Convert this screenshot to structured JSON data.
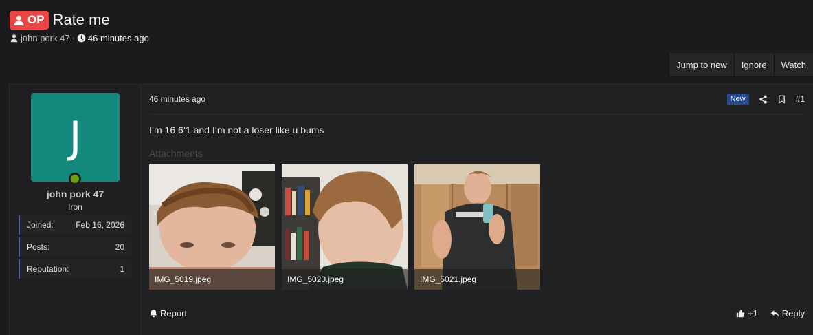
{
  "thread": {
    "op_badge": "OP",
    "title": "Rate me",
    "author": "john pork 47",
    "separator": "·",
    "time": "46 minutes ago"
  },
  "actions": [
    "Jump to new",
    "Ignore",
    "Watch"
  ],
  "user": {
    "avatar_letter": "J",
    "avatar_color": "#12897c",
    "online_color": "#66a50f",
    "name": "john pork 47",
    "rank": "Iron",
    "stats": [
      {
        "label": "Joined:",
        "value": "Feb 16, 2026"
      },
      {
        "label": "Posts:",
        "value": "20"
      },
      {
        "label": "Reputation:",
        "value": "1"
      }
    ]
  },
  "post": {
    "time": "46 minutes ago",
    "new_badge": "New",
    "number": "#1",
    "text": "I’m 16 6’1 and I’m not a loser like u bums",
    "attachments_label": "Attachments",
    "attachments": [
      {
        "filename": "IMG_5019.jpeg"
      },
      {
        "filename": "IMG_5020.jpeg"
      },
      {
        "filename": "IMG_5021.jpeg"
      }
    ],
    "report_label": "Report",
    "reaction_count": "+1",
    "reply_label": "Reply"
  },
  "icons": [
    "user-icon",
    "clock-icon",
    "share-icon",
    "bookmark-icon",
    "bell-icon",
    "thumbs-up-icon",
    "reply-icon"
  ],
  "colors": {
    "op_red": "#e94646",
    "new_blue": "#284a8f",
    "stat_accent": "#4a62a8"
  }
}
